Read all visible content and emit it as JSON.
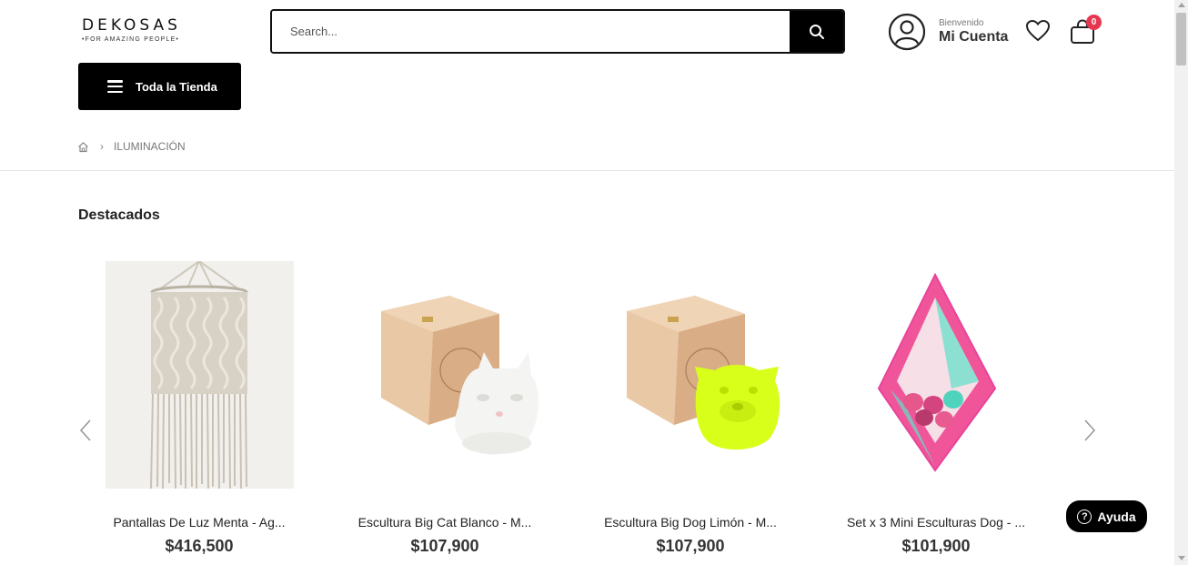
{
  "brand": {
    "name": "DEKOSAS",
    "tagline": "•FOR AMAZING PEOPLE•"
  },
  "search": {
    "placeholder": "Search..."
  },
  "account": {
    "greeting": "Bienvenido",
    "label": "Mi Cuenta"
  },
  "cart": {
    "count": "0"
  },
  "menu": {
    "store_label": "Toda la Tienda"
  },
  "breadcrumb": {
    "current": "ILUMINACIÓN"
  },
  "section": {
    "title": "Destacados"
  },
  "products": [
    {
      "name": "Pantallas De Luz Menta - Ag...",
      "price": "$416,500"
    },
    {
      "name": "Escultura Big Cat Blanco - M...",
      "price": "$107,900"
    },
    {
      "name": "Escultura Big Dog Limón - M...",
      "price": "$107,900"
    },
    {
      "name": "Set x 3 Mini Esculturas Dog - ...",
      "price": "$101,900"
    }
  ],
  "help": {
    "label": "Ayuda"
  },
  "colors": {
    "accent": "#000000",
    "badge": "#e63750",
    "lime": "#d8ff1a",
    "pink": "#f0559a",
    "teal": "#5fe0c8"
  }
}
